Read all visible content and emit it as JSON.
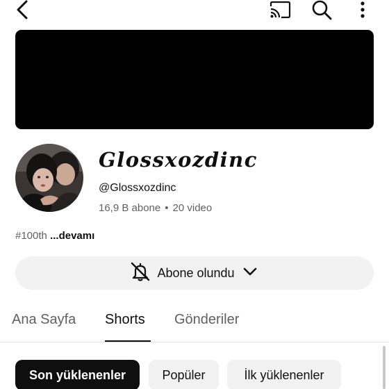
{
  "header": {
    "back_icon": "back-arrow-icon",
    "cast_icon": "cast-icon",
    "search_icon": "search-icon",
    "more_icon": "more-vertical-icon"
  },
  "channel": {
    "banner_color": "#000000",
    "title": "Glossxozdinc",
    "handle": "@Glossxozdinc",
    "subscribers": "16,9 B abone",
    "separator": "•",
    "video_count": "20 video",
    "description_tag": "#100th",
    "description_more": "...devamı"
  },
  "subscribe": {
    "label": "Abone olundu",
    "bell_icon": "bell-notifications-icon",
    "chevron_icon": "chevron-down-icon"
  },
  "tabs": [
    {
      "label": "Ana Sayfa",
      "active": false
    },
    {
      "label": "Shorts",
      "active": true
    },
    {
      "label": "Gönderiler",
      "active": false
    }
  ],
  "filters": [
    {
      "label": "Son yüklenenler",
      "selected": true
    },
    {
      "label": "Popüler",
      "selected": false
    },
    {
      "label": "İlk yüklenenler",
      "selected": false
    }
  ],
  "colors": {
    "text_primary": "#0f0f0f",
    "text_secondary": "#606060",
    "chip_bg": "#f2f2f2",
    "chip_selected_bg": "#0f0f0f"
  }
}
